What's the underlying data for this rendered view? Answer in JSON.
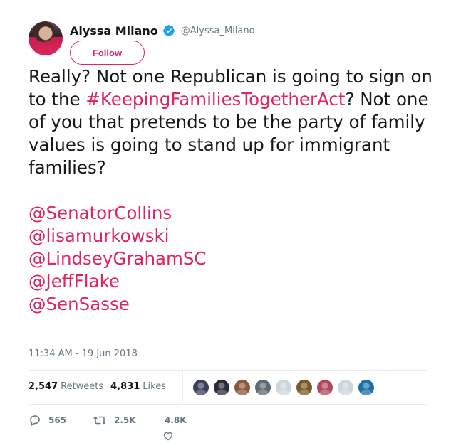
{
  "author": {
    "display_name": "Alyssa Milano",
    "handle": "@Alyssa_Milano",
    "verified": true
  },
  "follow_button": {
    "label": "Follow"
  },
  "tweet": {
    "segments": [
      {
        "type": "text",
        "value": "Really? Not one Republican is going to sign on to the "
      },
      {
        "type": "hashtag",
        "value": "#KeepingFamiliesTogetherAct"
      },
      {
        "type": "text",
        "value": "? Not one of you that pretends to be the party of family values is going to stand up for immigrant families?\n\n"
      },
      {
        "type": "mention",
        "value": "@SenatorCollins"
      },
      {
        "type": "text",
        "value": "\n"
      },
      {
        "type": "mention",
        "value": "@lisamurkowski"
      },
      {
        "type": "text",
        "value": "\n"
      },
      {
        "type": "mention",
        "value": "@LindseyGrahamSC"
      },
      {
        "type": "text",
        "value": "\n"
      },
      {
        "type": "mention",
        "value": "@JeffFlake"
      },
      {
        "type": "text",
        "value": "\n"
      },
      {
        "type": "mention",
        "value": "@SenSasse"
      }
    ]
  },
  "timestamp": "11:34 AM - 19 Jun 2018",
  "stats": {
    "retweets_count": "2,547",
    "retweets_label": "Retweets",
    "likes_count": "4,831",
    "likes_label": "Likes"
  },
  "liker_avatars": [
    {
      "name": "liker-avatar-1",
      "color": "#3b3f5c"
    },
    {
      "name": "liker-avatar-2",
      "color": "#2b2b3a"
    },
    {
      "name": "liker-avatar-3",
      "color": "#8a5a3c"
    },
    {
      "name": "liker-avatar-4",
      "color": "#5e6a73"
    },
    {
      "name": "liker-avatar-5",
      "color": "#ccd6dd"
    },
    {
      "name": "liker-avatar-6",
      "color": "#7a5a2a"
    },
    {
      "name": "liker-avatar-7",
      "color": "#b0485a"
    },
    {
      "name": "liker-avatar-8",
      "color": "#ccd6dd"
    },
    {
      "name": "liker-avatar-9",
      "color": "#1d6fa5"
    }
  ],
  "actions": {
    "reply_count": "565",
    "retweet_count": "2.5K",
    "like_count": "4.8K",
    "reply_icon": "reply-icon",
    "retweet_icon": "retweet-icon",
    "like_icon": "heart-icon"
  },
  "colors": {
    "accent": "#e0245e",
    "verified": "#1da1f2",
    "secondary_text": "#657786",
    "divider": "#e6ecf0"
  }
}
